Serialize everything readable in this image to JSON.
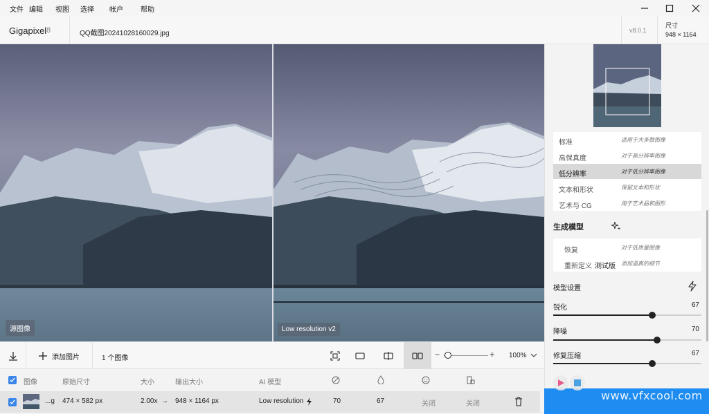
{
  "menu": [
    "文件",
    "编辑",
    "视图",
    "选择",
    "帐户",
    "帮助"
  ],
  "app": {
    "name": "Gigapixel",
    "version_major": "8",
    "filename": "QQ截图20241028160029.jpg",
    "version": "v8.0.1",
    "size_label": "尺寸",
    "size_value": "948 × 1164"
  },
  "viewer": {
    "left_label": "源图像",
    "right_label": "Low resolution v2"
  },
  "models": [
    {
      "name": "标准",
      "desc": "适用于大多数图像",
      "selected": false
    },
    {
      "name": "高保真度",
      "desc": "对于高分辨率图像",
      "selected": false
    },
    {
      "name": "低分辨率",
      "desc": "对于低分辨率图像",
      "selected": true
    },
    {
      "name": "文本和形状",
      "desc": "保留文本和形状",
      "selected": false
    },
    {
      "name": "艺术与 CG",
      "desc": "用于艺术品和图形",
      "selected": false
    }
  ],
  "generative": {
    "title": "生成模型",
    "items": [
      {
        "name": "恢复",
        "desc": "对于低质量图像"
      },
      {
        "name": "重新定义",
        "badge": "测试版",
        "desc": "添加逼真的细节"
      }
    ]
  },
  "settings": {
    "title": "模型设置",
    "sliders": [
      {
        "label": "锐化",
        "value": 67
      },
      {
        "label": "降噪",
        "value": 70
      },
      {
        "label": "修复压缩",
        "value": 67
      }
    ]
  },
  "toolbar": {
    "add_label": "添加图片",
    "count_label": "1 个图像",
    "zoom": "100%"
  },
  "table": {
    "headers": [
      "图像",
      "原始尺寸",
      "大小",
      "输出大小",
      "AI 模型"
    ],
    "row": {
      "name": "...g",
      "orig": "474 × 582 px",
      "scale": "2.00x",
      "arrow": "→",
      "out": "948 × 1164 px",
      "model": "Low resolution",
      "v1": "70",
      "v2": "67",
      "v3": "关闭",
      "v4": "关闭"
    }
  },
  "watermark": "www.vfxcool.com",
  "colors": {
    "accent": "#1e8cf0",
    "checkbox": "#3b86ea"
  }
}
